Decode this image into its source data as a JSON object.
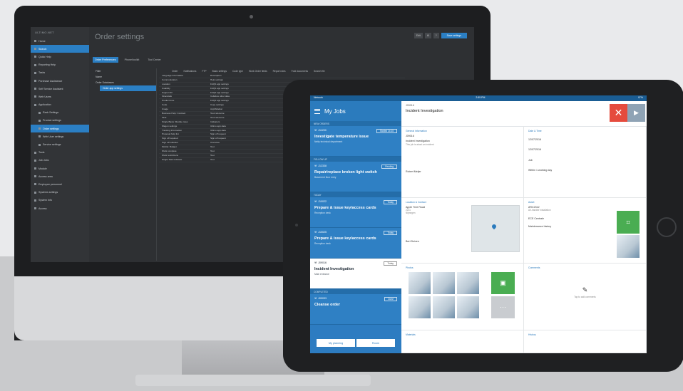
{
  "desktop": {
    "logo": "ULTIMO.NET",
    "page_title": "Order settings",
    "toolbar": {
      "edit": "Edit",
      "primary": "Save settings",
      "secondary": "Preview"
    },
    "tabs": [
      "Order Preferences",
      "Phone/toolkit",
      "Tool Center"
    ],
    "sidebar": [
      {
        "label": "Home"
      },
      {
        "label": "Search",
        "active": true
      },
      {
        "label": "Quick Help"
      },
      {
        "label": "Reporting Help"
      },
      {
        "label": "Tasks"
      },
      {
        "label": "Purchase Assistance"
      },
      {
        "label": "Self Service Assistant"
      },
      {
        "label": "Web Users"
      },
      {
        "label": "Application"
      },
      {
        "label": "Rack Settings",
        "sub": true
      },
      {
        "label": "Product settings",
        "sub": true
      },
      {
        "label": "Order settings",
        "sub": true,
        "active": true
      },
      {
        "label": "Web User settings",
        "sub": true
      },
      {
        "label": "Service settings",
        "sub": true
      },
      {
        "label": "Tools"
      },
      {
        "label": "Job Jobs"
      },
      {
        "label": "Module"
      },
      {
        "label": "Access area"
      },
      {
        "label": "Employee personnel"
      },
      {
        "label": "Systems settings"
      },
      {
        "label": "System Info"
      },
      {
        "label": "Access"
      }
    ],
    "tree": [
      "Filter",
      "Name",
      "Order Databases",
      "Order app settings"
    ],
    "grid_tabs": [
      "Order",
      "Notifications",
      "FTP",
      "Basic settings",
      "Code type",
      "Work Order fields",
      "Report rules",
      "Fold documents",
      "Search file"
    ],
    "grid_rows": [
      [
        "Language Information",
        "Description"
      ],
      [
        "Communication",
        "Help settings"
      ],
      [
        "Location",
        "FAQS app settings"
      ],
      [
        "Usability",
        "FAQS app settings"
      ],
      [
        "Support ID",
        "FAQS app settings"
      ],
      [
        "Financials",
        "Collabox other data"
      ],
      [
        "Product time",
        "FAQS app settings"
      ],
      [
        "Code",
        "Copy settings"
      ],
      [
        "Usage",
        "App/Sidebar"
      ],
      [
        "Business Help: Contract",
        "Test reference"
      ],
      [
        "Task",
        "Test reference"
      ],
      [
        "Single Basis: Module rules",
        "Indicators"
      ],
      [
        "Wagon settings",
        "Ultimo app data"
      ],
      [
        "Tracking Information",
        "Ultimo app data"
      ],
      [
        "Proposal help list",
        "Sign off request"
      ],
      [
        "Sign off required",
        "Sign off request"
      ],
      [
        "Sign off indicator",
        "Overview"
      ],
      [
        "Mobile: Budget",
        "Test"
      ],
      [
        "Work complete",
        "Test"
      ],
      [
        "Work restrictions",
        "Test"
      ],
      [
        "Single Task indicator",
        "Test"
      ]
    ]
  },
  "tablet": {
    "status_left": "Network",
    "status_time": "2:55 PM",
    "status_right": "97%",
    "header": "My Jobs",
    "sections": [
      "NEW ORDERS",
      "FOLLOW UP",
      "TODAY",
      "COMPLETED"
    ],
    "cards": [
      {
        "id": "J11200",
        "tag": "Started 14:15",
        "name": "Investigate temperature issue",
        "desc": "Netty technical department",
        "style": "blue"
      },
      {
        "id": "J12338",
        "tag": "Pending",
        "name": "Repair/replace broken light switch",
        "desc": "Basement floor entry",
        "style": "blue"
      },
      {
        "id": "J10022",
        "tag": "Today",
        "name": "Prepare & issue key/access cards",
        "desc": "Reception desk",
        "style": "blue"
      },
      {
        "id": "J10025",
        "tag": "Today",
        "name": "Prepare & issue key/access cards",
        "desc": "Reception desk",
        "style": "blue"
      },
      {
        "id": "J09016",
        "tag": "Today",
        "name": "Incident Investigation",
        "desc": "Main entrance",
        "style": "white"
      },
      {
        "id": "J09033",
        "tag": "Done",
        "name": "Cleanse order",
        "desc": "",
        "style": "blue"
      }
    ],
    "footer": {
      "left": "My planning",
      "right": "Room"
    },
    "detail": {
      "id": "J09016",
      "title": "Incident Investigation",
      "general": "General information",
      "general_lines": [
        "J09016",
        "Incident Investigation",
        "This job is about an incident"
      ],
      "reporter": "Robert Meijer",
      "location_title": "Location & Contact",
      "location_lines": [
        "Apple Tree Road",
        "2211",
        "Nijmegen"
      ],
      "contact": "Bert Duiven",
      "date_title": "Date & Time",
      "date_lines": [
        "12/07/2016",
        "12/07/2016",
        "Job",
        "Within 1 working day"
      ],
      "asset_title": "Asset",
      "asset_lines": [
        "ARC2312",
        "Air-handler installation",
        "ECE Centrale",
        "Maintenance history"
      ],
      "photos_title": "Photos",
      "comments_title": "Comments",
      "comments_hint": "Tap to add comments",
      "materials_title": "Materials",
      "history_title": "History"
    }
  }
}
